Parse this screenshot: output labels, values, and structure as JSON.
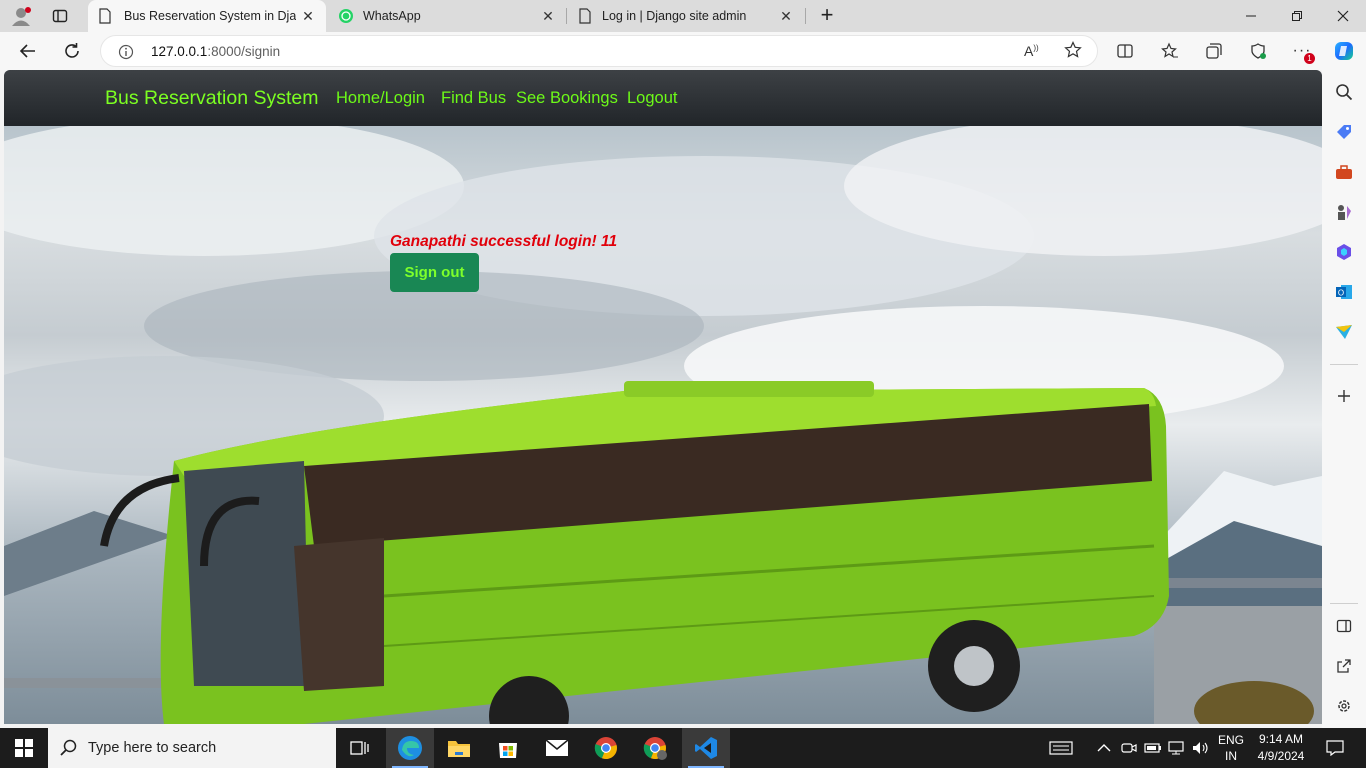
{
  "browser": {
    "tabs": [
      {
        "title": "Bus Reservation System in Django",
        "active": true
      },
      {
        "title": "WhatsApp",
        "active": false
      },
      {
        "title": "Log in | Django site admin",
        "active": false
      }
    ],
    "new_tab_glyph": "+",
    "address": {
      "host": "127.0.0.1",
      "rest": ":8000/signin"
    },
    "profile_badge_count": "1"
  },
  "site": {
    "brand": "Bus Reservation System",
    "nav": [
      "Home/Login",
      "Find Bus",
      "See Bookings",
      "Logout"
    ],
    "message": "Ganapathi successful login! 11",
    "signout_label": "Sign out",
    "colors": {
      "brand": "#7cff22",
      "message": "#e1000b",
      "button": "#198754"
    }
  },
  "taskbar": {
    "search_placeholder": "Type here to search",
    "lang_top": "ENG",
    "lang_bottom": "IN",
    "time": "9:14 AM",
    "date": "4/9/2024"
  }
}
